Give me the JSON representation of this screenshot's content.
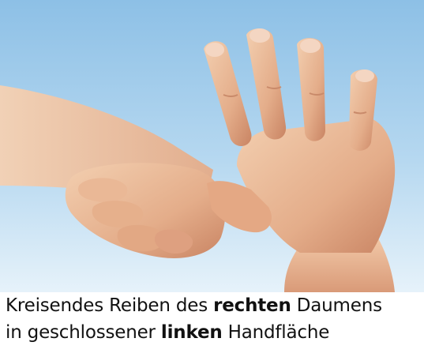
{
  "caption": {
    "line1_pre": "Kreisendes Reiben des ",
    "line1_bold": "rechten",
    "line1_post": " Daumens",
    "line2_pre": "in geschlossener ",
    "line2_bold": "linken",
    "line2_post": " Handfläche"
  },
  "colors": {
    "background_top": "#9ac8e8",
    "background_bottom": "#e4f1fa",
    "skin_light": "#f0c8a8",
    "skin_mid": "#dda07e",
    "skin_dark": "#c07a5c",
    "text": "#111111"
  }
}
